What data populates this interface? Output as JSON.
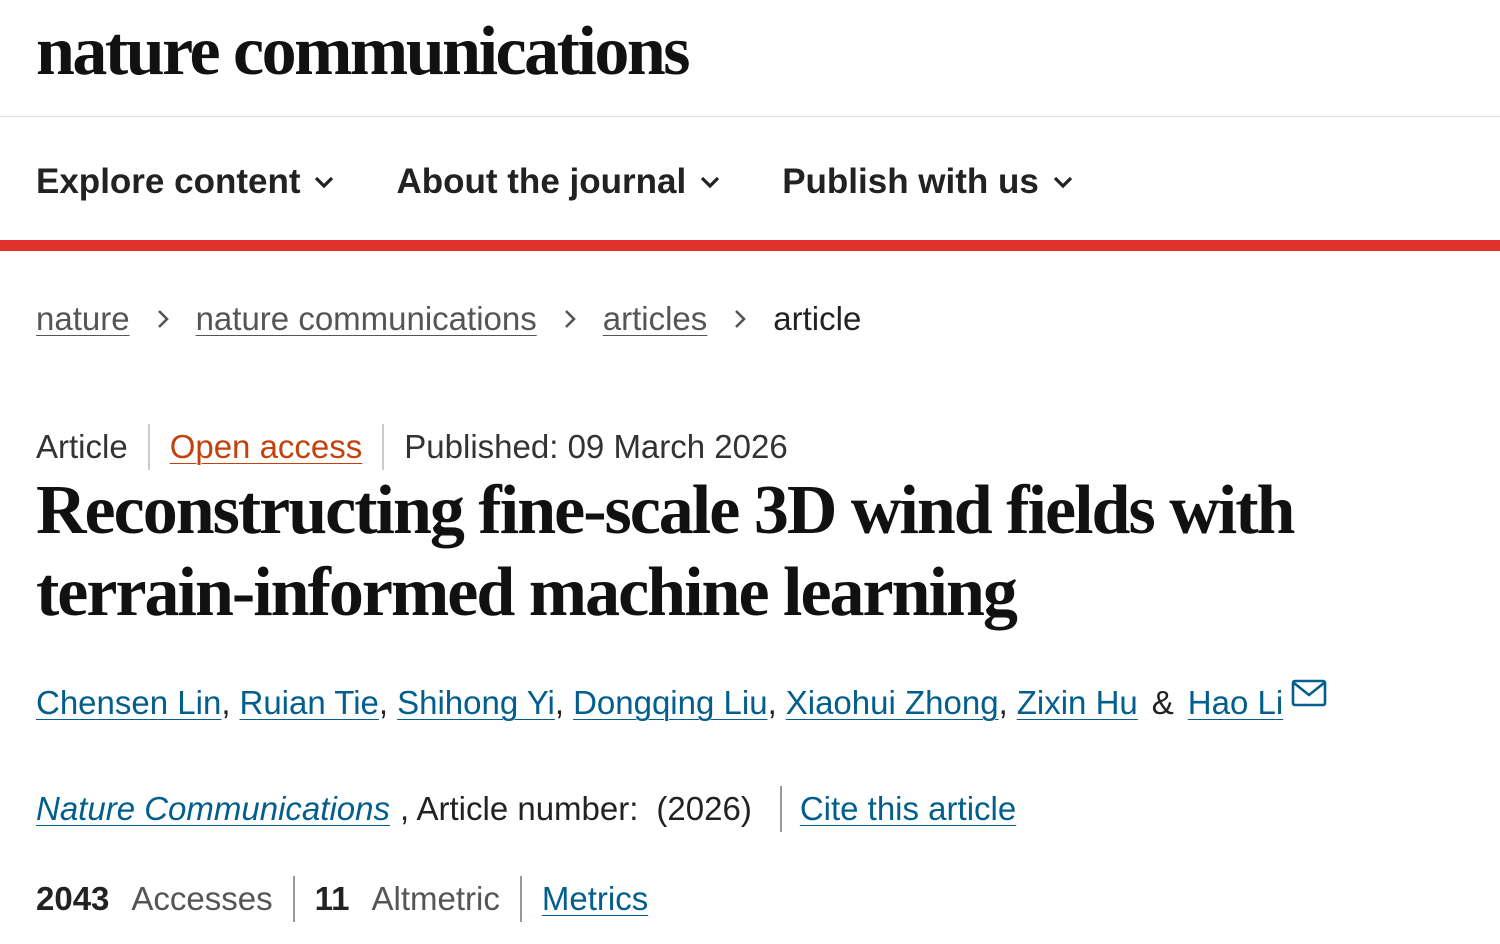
{
  "header": {
    "logo_text": "nature communications"
  },
  "nav": {
    "items": [
      {
        "label": "Explore content"
      },
      {
        "label": "About the journal"
      },
      {
        "label": "Publish with us"
      }
    ]
  },
  "breadcrumb": {
    "items": [
      "nature",
      "nature communications",
      "articles"
    ],
    "current": "article"
  },
  "article": {
    "type": "Article",
    "access": "Open access",
    "published": "Published: 09 March 2026",
    "title": "Reconstructing fine-scale 3D wind fields with terrain-informed machine learning",
    "authors": [
      "Chensen Lin",
      "Ruian Tie",
      "Shihong Yi",
      "Dongqing Liu",
      "Xiaohui Zhong",
      "Zixin Hu",
      "Hao Li"
    ],
    "author_separator": ",",
    "author_last_joiner": "&",
    "journal": "Nature Communications",
    "article_number_label": ", Article number:",
    "year": "(2026)",
    "cite_label": "Cite this article",
    "accesses_count": "2043",
    "accesses_label": "Accesses",
    "altmetric_count": "11",
    "altmetric_label": "Altmetric",
    "metrics_label": "Metrics"
  },
  "colors": {
    "accent_red": "#e0312a",
    "link_blue": "#025e8d",
    "open_access_orange": "#c4410c"
  },
  "icons": {
    "nav_chevron": "chevron-down-icon",
    "breadcrumb_separator": "chevron-right-icon",
    "corresponding_author": "mail-icon"
  }
}
